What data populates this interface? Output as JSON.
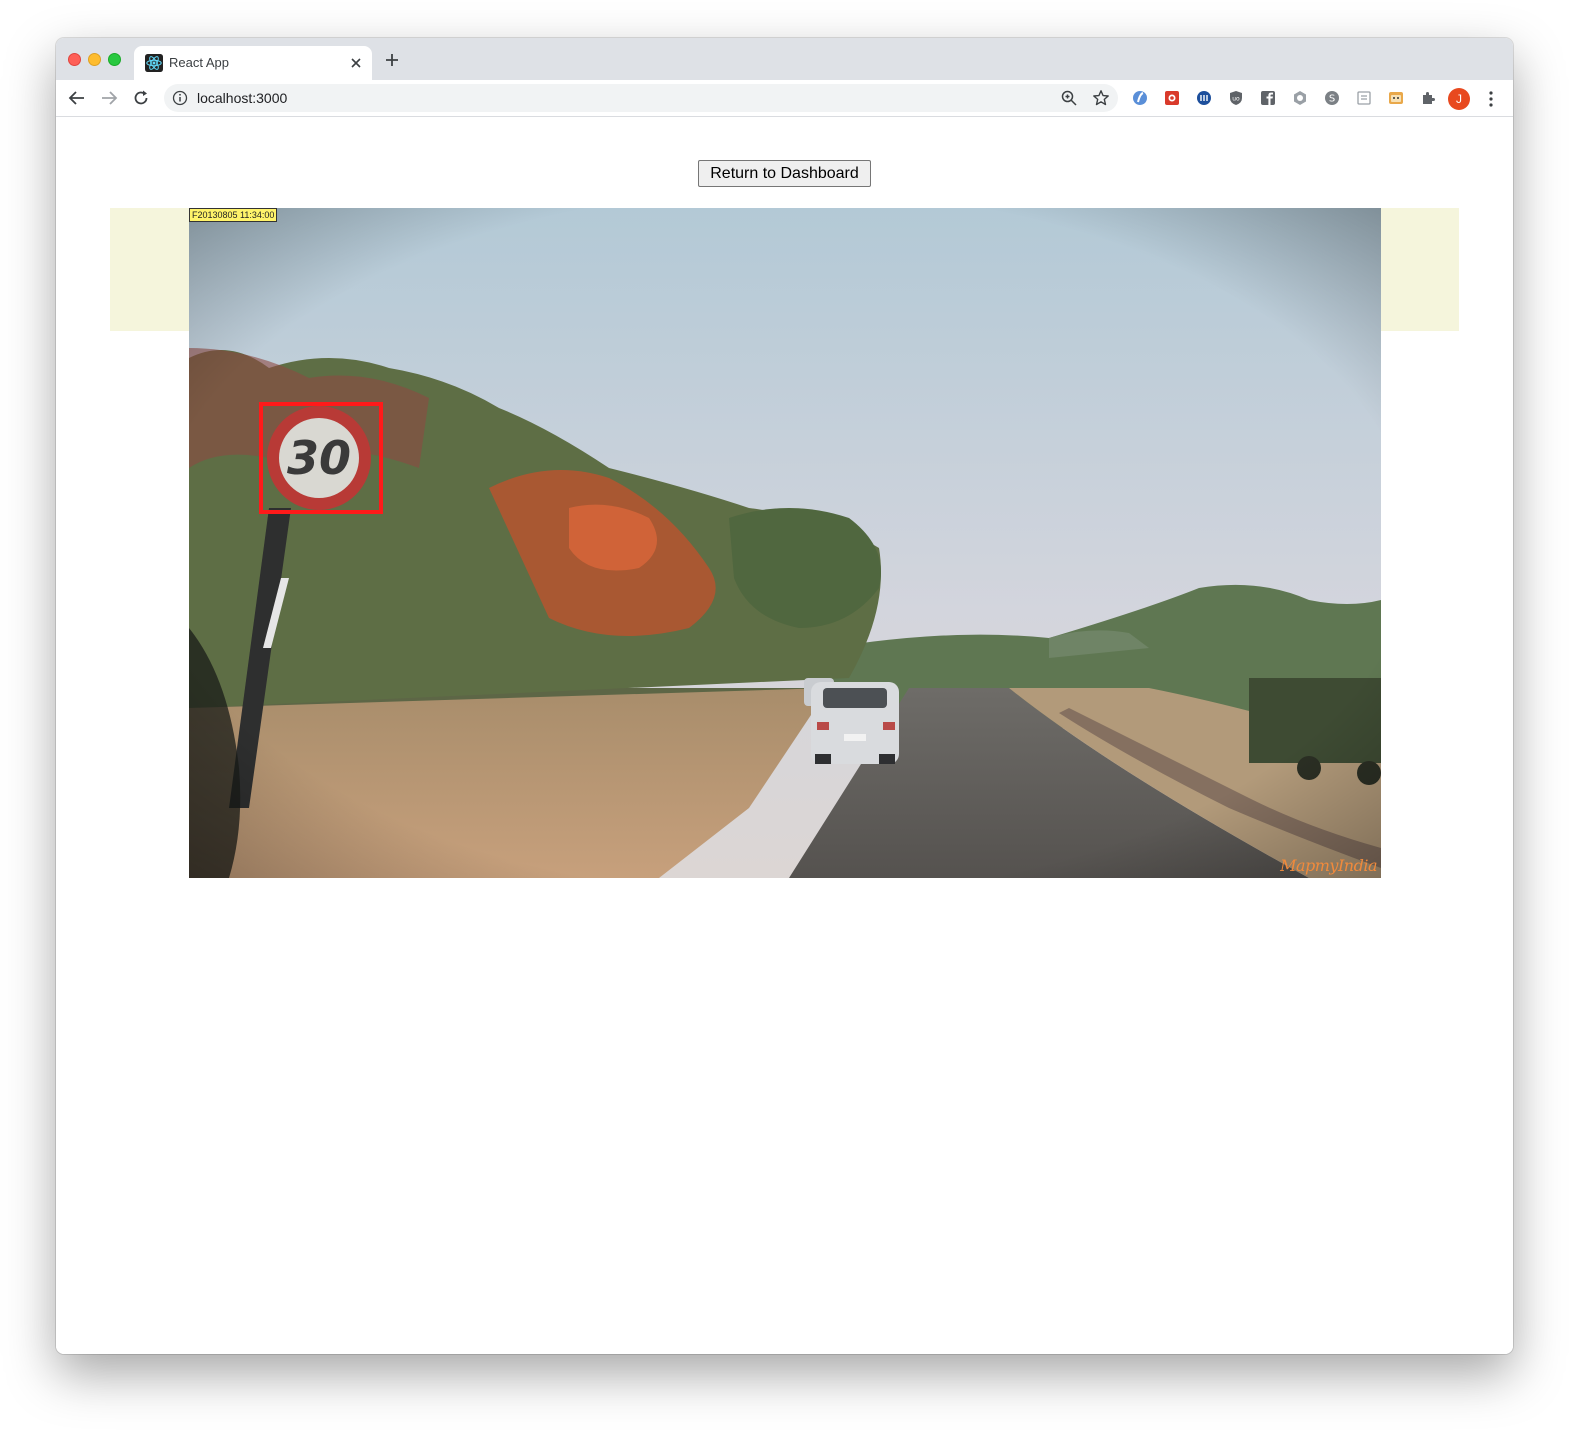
{
  "browser": {
    "tab_title": "React App",
    "url": "localhost:3000",
    "profile_initial": "J",
    "profile_color": "#e8491f"
  },
  "page": {
    "return_button_label": "Return to Dashboard",
    "image_timestamp": "F20130805 11:34:00",
    "watermark": "MapmyIndia",
    "detected_sign_text": "30",
    "band_color": "#f5f5dc",
    "detection_box_color": "#ff1a1a"
  },
  "icons": {
    "tab_favicon": "react-icon",
    "extensions": [
      "extension-1-icon",
      "extension-2-icon",
      "extension-3-icon",
      "extension-4-icon",
      "extension-5-icon",
      "extension-6-icon",
      "extension-7-icon",
      "extension-8-icon",
      "extension-9-icon",
      "puzzle-icon"
    ]
  }
}
